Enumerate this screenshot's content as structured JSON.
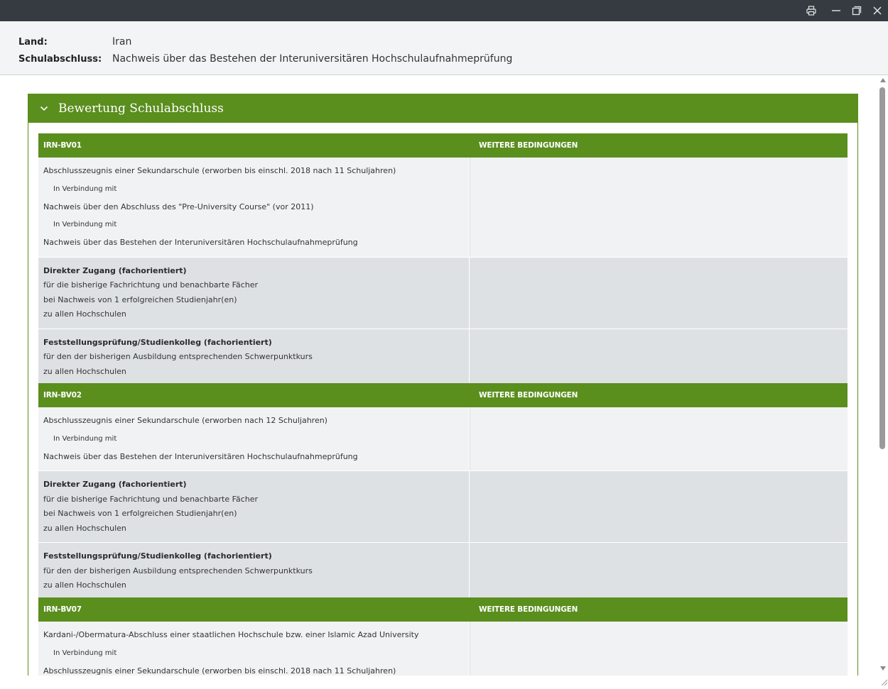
{
  "info": {
    "land_label": "Land:",
    "land_value": "Iran",
    "schulabschluss_label": "Schulabschluss:",
    "schulabschluss_value": "Nachweis über das Bestehen der Interuniversitären Hochschulaufnahmeprüfung"
  },
  "panel": {
    "title": "Bewertung Schulabschluss"
  },
  "blocks": [
    {
      "code": "IRN-BV01",
      "col2": "WEITERE BEDINGUNGEN",
      "requirements": [
        "Abschlusszeugnis einer Sekundarschule (erworben bis einschl. 2018 nach 11 Schuljahren)",
        "In Verbindung mit",
        "Nachweis über den Abschluss des \"Pre-University Course\" (vor 2011)",
        "In Verbindung mit",
        "Nachweis über das Bestehen der Interuniversitären Hochschulaufnahmeprüfung"
      ],
      "access1": {
        "title": "Direkter Zugang (fachorientiert)",
        "l1": "für die bisherige Fachrichtung und benachbarte Fächer",
        "l2": "bei Nachweis von 1 erfolgreichen Studienjahr(en)",
        "l3": "zu allen Hochschulen"
      },
      "access2": {
        "title": "Feststellungsprüfung/Studienkolleg (fachorientiert)",
        "l1": "für den der bisherigen Ausbildung entsprechenden Schwerpunktkurs",
        "l2": "zu allen Hochschulen"
      }
    },
    {
      "code": "IRN-BV02",
      "col2": "WEITERE BEDINGUNGEN",
      "requirements": [
        "Abschlusszeugnis einer Sekundarschule (erworben nach 12 Schuljahren)",
        "In Verbindung mit",
        "Nachweis über das Bestehen der Interuniversitären Hochschulaufnahmeprüfung"
      ],
      "access1": {
        "title": "Direkter Zugang (fachorientiert)",
        "l1": "für die bisherige Fachrichtung und benachbarte Fächer",
        "l2": "bei Nachweis von 1 erfolgreichen Studienjahr(en)",
        "l3": "zu allen Hochschulen"
      },
      "access2": {
        "title": "Feststellungsprüfung/Studienkolleg (fachorientiert)",
        "l1": "für den der bisherigen Ausbildung entsprechenden Schwerpunktkurs",
        "l2": "zu allen Hochschulen"
      }
    },
    {
      "code": "IRN-BV07",
      "col2": "WEITERE BEDINGUNGEN",
      "requirements": [
        "Kardani-/Obermatura-Abschluss einer staatlichen Hochschule bzw. einer Islamic Azad University",
        "In Verbindung mit",
        "Abschlusszeugnis einer Sekundarschule (erworben bis einschl. 2018 nach 11 Schuljahren)"
      ]
    }
  ],
  "icons": {
    "print": "print-icon",
    "minimize": "minimize-icon",
    "maximize": "restore-icon",
    "close": "close-icon",
    "collapse": "chevron-down-icon"
  },
  "colors": {
    "accent_green": "#5a8e1d",
    "titlebar": "#353b41",
    "row_light": "#f1f2f3",
    "row_gray": "#dee1e4"
  }
}
